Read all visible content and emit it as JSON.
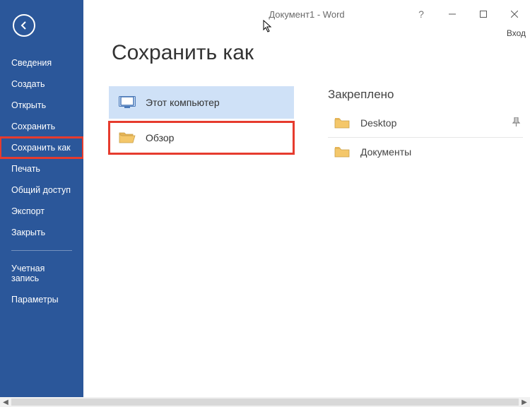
{
  "window": {
    "title": "Документ1 - Word",
    "sign_in": "Вход"
  },
  "sidebar": {
    "items": [
      {
        "label": "Сведения"
      },
      {
        "label": "Создать"
      },
      {
        "label": "Открыть"
      },
      {
        "label": "Сохранить"
      },
      {
        "label": "Сохранить как"
      },
      {
        "label": "Печать"
      },
      {
        "label": "Общий доступ"
      },
      {
        "label": "Экспорт"
      },
      {
        "label": "Закрыть"
      }
    ],
    "footer": [
      {
        "label": "Учетная запись"
      },
      {
        "label": "Параметры"
      }
    ]
  },
  "page": {
    "heading": "Сохранить как",
    "sources": [
      {
        "label": "Этот компьютер"
      },
      {
        "label": "Обзор"
      }
    ],
    "pinned_section": "Закреплено",
    "pinned": [
      {
        "label": "Desktop",
        "pinned": true
      },
      {
        "label": "Документы",
        "pinned": false
      }
    ]
  },
  "icons": {
    "monitor": "monitor-icon",
    "folder": "folder-icon",
    "pin": "📌"
  }
}
